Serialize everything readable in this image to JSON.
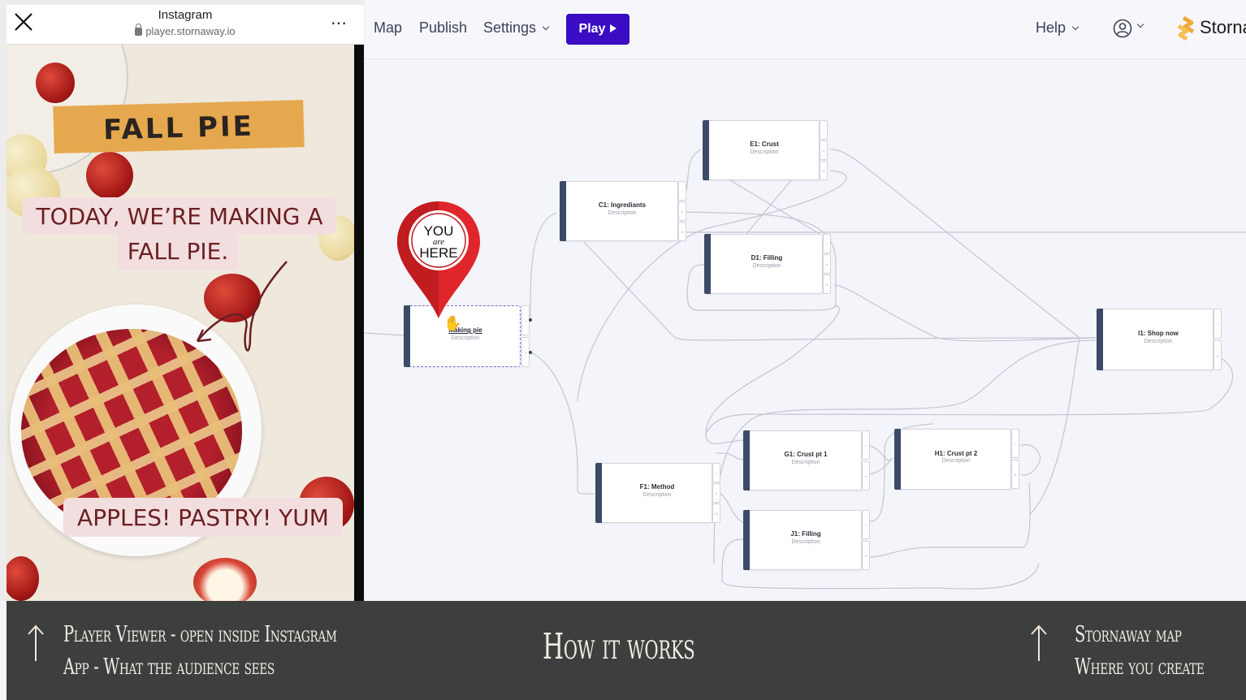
{
  "instagram": {
    "app_title": "Instagram",
    "url": "player.stornaway.io",
    "close_icon": "close-x-icon",
    "more_icon": "ellipsis-icon",
    "lock_icon": "lock-icon"
  },
  "video": {
    "banner": "FALL PIE",
    "caption_line1": "TODAY, WE’RE MAKING A",
    "caption_line2": "FALL PIE.",
    "caption_bottom": "APPLES! PASTRY! YUM",
    "colors": {
      "banner_bg": "#e6a84e",
      "caption_bg": "#f3dedf",
      "caption_text": "#6b1f22"
    }
  },
  "toolbar": {
    "nav": [
      {
        "label": "Map"
      },
      {
        "label": "Publish"
      },
      {
        "label": "Settings",
        "has_dropdown": true
      }
    ],
    "play_label": "Play",
    "help_label": "Help",
    "account_icon": "user-circle-icon",
    "brand_name": "Storna",
    "brand_logo": "stornaway-logo-icon",
    "accent": "#3a0cc4"
  },
  "pin": {
    "line1": "YOU",
    "line2": "are",
    "line3": "HERE",
    "color": "#e0262a"
  },
  "map": {
    "nodes": [
      {
        "id": "B1",
        "title": "Making pie",
        "description": "Description",
        "ports": [
          "I",
          "II"
        ],
        "selected": true
      },
      {
        "id": "C1",
        "title": "C1: Ingrediants",
        "description": "Description",
        "ports": [
          "I",
          "II",
          "III"
        ]
      },
      {
        "id": "E1",
        "title": "E1: Crust",
        "description": "Description",
        "ports": [
          "I",
          "II",
          "III"
        ]
      },
      {
        "id": "D1",
        "title": "D1: Filling",
        "description": "Description",
        "ports": [
          "I",
          "II",
          "III"
        ]
      },
      {
        "id": "I1",
        "title": "I1: Shop now",
        "description": "Description",
        "ports": [
          "I",
          "II"
        ]
      },
      {
        "id": "F1",
        "title": "F1: Method",
        "description": "Description",
        "ports": [
          "I",
          "II",
          "III"
        ]
      },
      {
        "id": "G1",
        "title": "G1: Crust pt 1",
        "description": "Description",
        "ports": [
          "I",
          "II"
        ]
      },
      {
        "id": "H1",
        "title": "H1: Crust pt 2",
        "description": "Description",
        "ports": [
          "I",
          "II"
        ]
      },
      {
        "id": "J1",
        "title": "J1: Filling",
        "description": "Description",
        "ports": [
          "I",
          "II"
        ]
      }
    ]
  },
  "band": {
    "left_line1": "Player Viewer - open inside Instagram",
    "left_line2": "App - What the audience sees",
    "center": "How it works",
    "right_line1": "Stornaway map",
    "right_line2": "Where you create",
    "arrow_icon": "arrow-up-icon"
  }
}
